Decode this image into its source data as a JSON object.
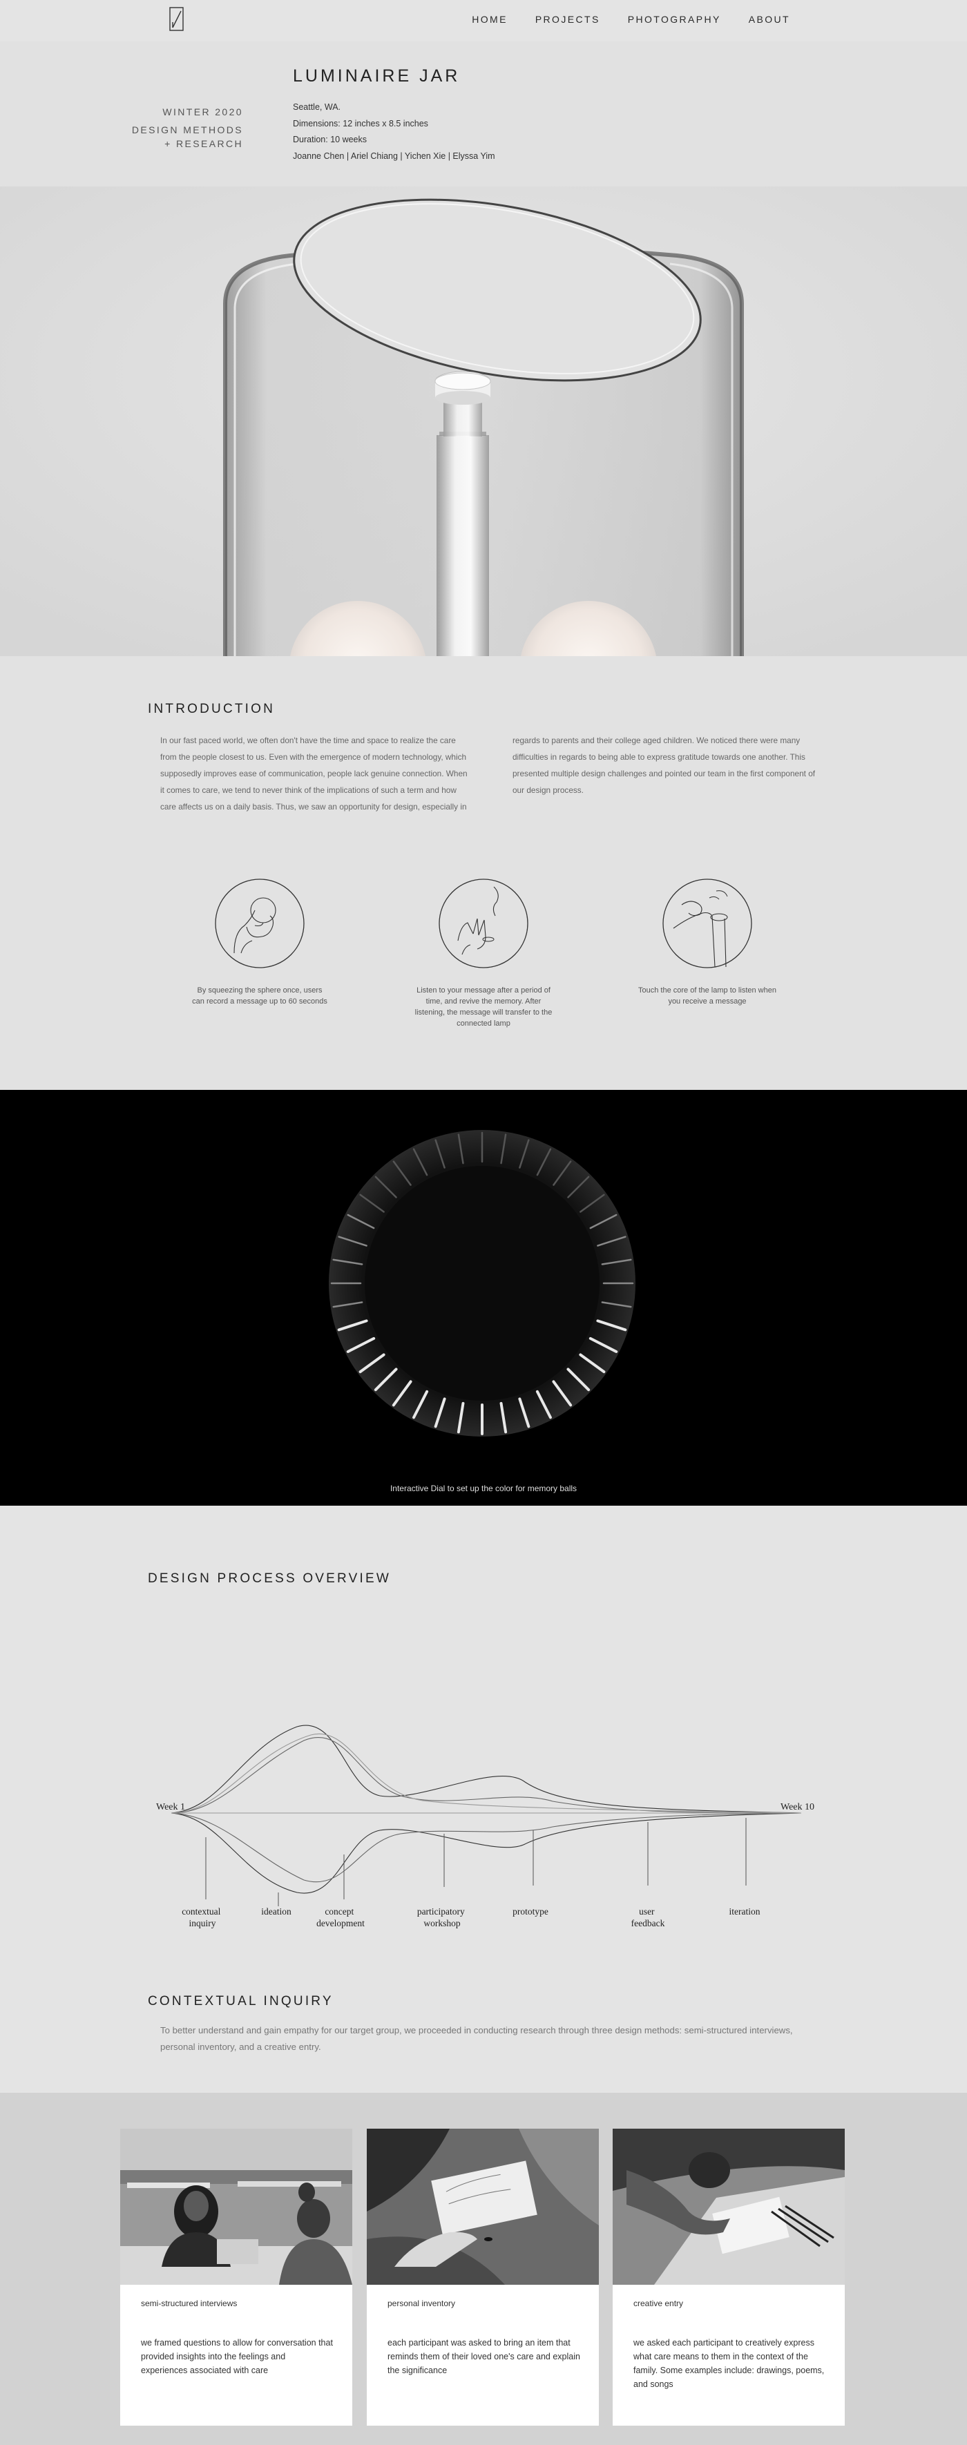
{
  "nav": {
    "logo": "logo-mark",
    "links": [
      "HOME",
      "PROJECTS",
      "PHOTOGRAPHY",
      "ABOUT"
    ]
  },
  "project": {
    "title": "LUMINAIRE JAR",
    "season": [
      "WINTER 2020",
      "DESIGN METHODS",
      "+ RESEARCH"
    ],
    "meta": [
      "Seattle, WA.",
      "Dimensions: 12 inches x 8.5 inches",
      "Duration: 10 weeks",
      "Joanne Chen | Ariel Chiang | Yichen Xie | Elyssa Yim"
    ]
  },
  "intro": {
    "heading": "INTRODUCTION",
    "col1": "In our fast paced world, we often don't have the time and space to realize the care from the people closest to us. Even with the emergence of modern technology, which supposedly improves ease of communication, people lack genuine connection. When it comes to care, we tend to never think of the implications of such a term and how care affects us on a daily basis. Thus, we saw an opportunity for design, especially in",
    "col2": "regards to parents and their college aged children. We noticed there were many difficulties in regards to being able to express gratitude towards one another. This presented multiple design challenges and pointed our team in the first component of our design process.",
    "features": [
      {
        "icon": "hand-squeeze-sphere-icon",
        "text": "By squeezing the sphere once, users can record a message up to 60 seconds"
      },
      {
        "icon": "hand-open-lamp-icon",
        "text": "Listen to your message after a period of time, and revive the memory. After listening, the message will transfer to the connected lamp"
      },
      {
        "icon": "hand-touch-lamp-core-icon",
        "text": "Touch the core of the lamp to listen when you receive a message"
      }
    ]
  },
  "dial": {
    "caption": "Interactive Dial to set up the color for memory balls"
  },
  "process": {
    "heading": "DESIGN PROCESS OVERVIEW",
    "start_label": "Week 1",
    "end_label": "Week 10",
    "stages": [
      [
        "contextual",
        "inquiry"
      ],
      [
        "ideation"
      ],
      [
        "concept",
        "development"
      ],
      [
        "participatory",
        "workshop"
      ],
      [
        "prototype"
      ],
      [
        "user",
        "feedback"
      ],
      [
        "iteration"
      ]
    ]
  },
  "contextual": {
    "heading": "CONTEXTUAL INQUIRY",
    "text": "To better understand and gain empathy for our target group, we proceeded in conducting research through three design methods: semi-structured interviews, personal inventory, and a creative entry."
  },
  "cards": [
    {
      "label": "semi-structured interviews",
      "body": "we framed questions to allow for conversation that provided insights into the feelings and experiences associated with care"
    },
    {
      "label": "personal inventory",
      "body": "each participant was asked to bring an item that reminds them of their loved one's care and explain the significance"
    },
    {
      "label": "creative entry",
      "body": "we asked each participant to creatively express what care means to them in the context of the family. Some examples include: drawings, poems, and songs"
    }
  ]
}
